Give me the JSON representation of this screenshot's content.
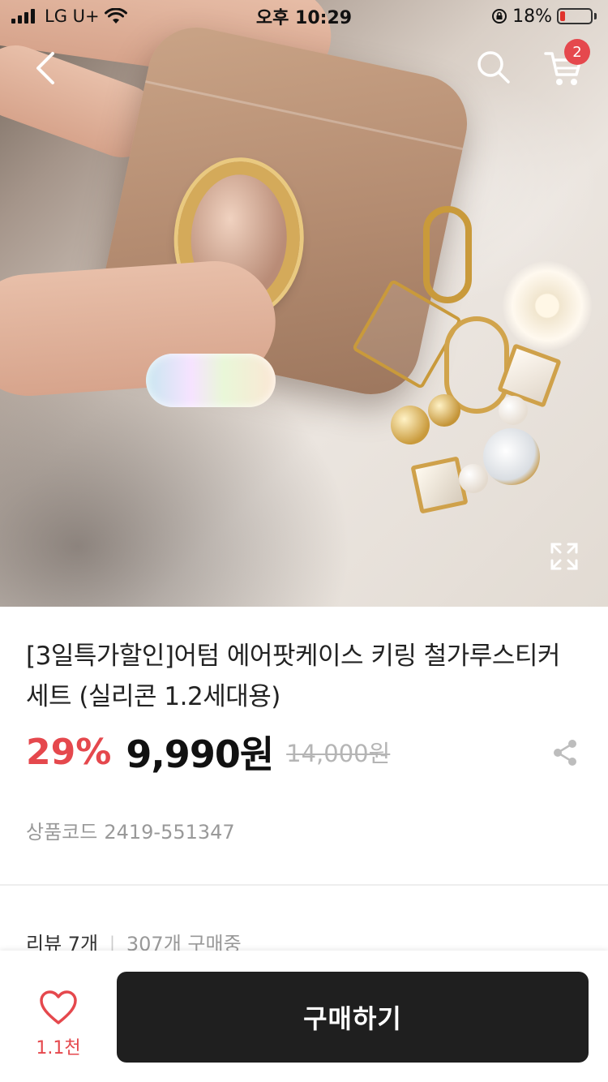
{
  "status_bar": {
    "carrier": "LG U+",
    "time": "오후 10:29",
    "battery": "18%",
    "battery_level": 0.18,
    "battery_color": "#e0332c"
  },
  "header": {
    "back_icon": "chevron-left-icon",
    "search_icon": "search-icon",
    "cart_icon": "cart-icon",
    "cart_count": "2"
  },
  "hero": {
    "expand_icon": "expand-icon"
  },
  "product": {
    "title": "[3일특가할인]어텀 에어팟케이스 키링 철가루스티커 세트 (실리콘 1.2세대용)",
    "discount": "29%",
    "price": "9,990원",
    "original_price": "14,000원",
    "share_icon": "share-icon",
    "code_label": "상품코드",
    "code_value": "2419-551347"
  },
  "reviews": {
    "review_label": "리뷰 7개",
    "separator": "|",
    "buying": "307개 구매중"
  },
  "bottom_bar": {
    "like_count": "1.1천",
    "buy_label": "구매하기"
  },
  "colors": {
    "accent": "#e5484d",
    "button_bg": "#1f1f1f"
  }
}
